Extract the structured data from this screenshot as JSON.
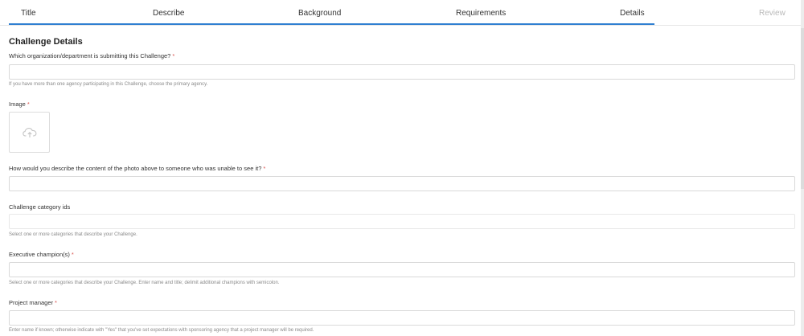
{
  "tabs": [
    {
      "label": "Title"
    },
    {
      "label": "Describe"
    },
    {
      "label": "Background"
    },
    {
      "label": "Requirements"
    },
    {
      "label": "Details"
    },
    {
      "label": "Review"
    }
  ],
  "section_title": "Challenge Details",
  "required_marker": "*",
  "fields": {
    "organization": {
      "label": "Which organization/department is submitting this Challenge?",
      "help": "If you have more than one agency participating in this Challenge, choose the primary agency."
    },
    "image": {
      "label": "Image",
      "icon": "upload-cloud-icon"
    },
    "alt_text": {
      "label": "How would you describe the content of the photo above to someone who was unable to see it?"
    },
    "category": {
      "label": "Challenge category ids",
      "help": "Select one or more categories that describe your Challenge."
    },
    "executive": {
      "label": "Executive champion(s)",
      "help": "Select one or more categories that describe your Challenge. Enter name and title; delimit additional champions with semicolon."
    },
    "project_manager": {
      "label": "Project manager",
      "help": "Enter name if known; otherwise indicate with \"Yes\" that you've set expectations with sponsoring agency that a project manager will be required."
    }
  },
  "colors": {
    "accent": "#2f7fd1",
    "required": "#d9534f"
  }
}
